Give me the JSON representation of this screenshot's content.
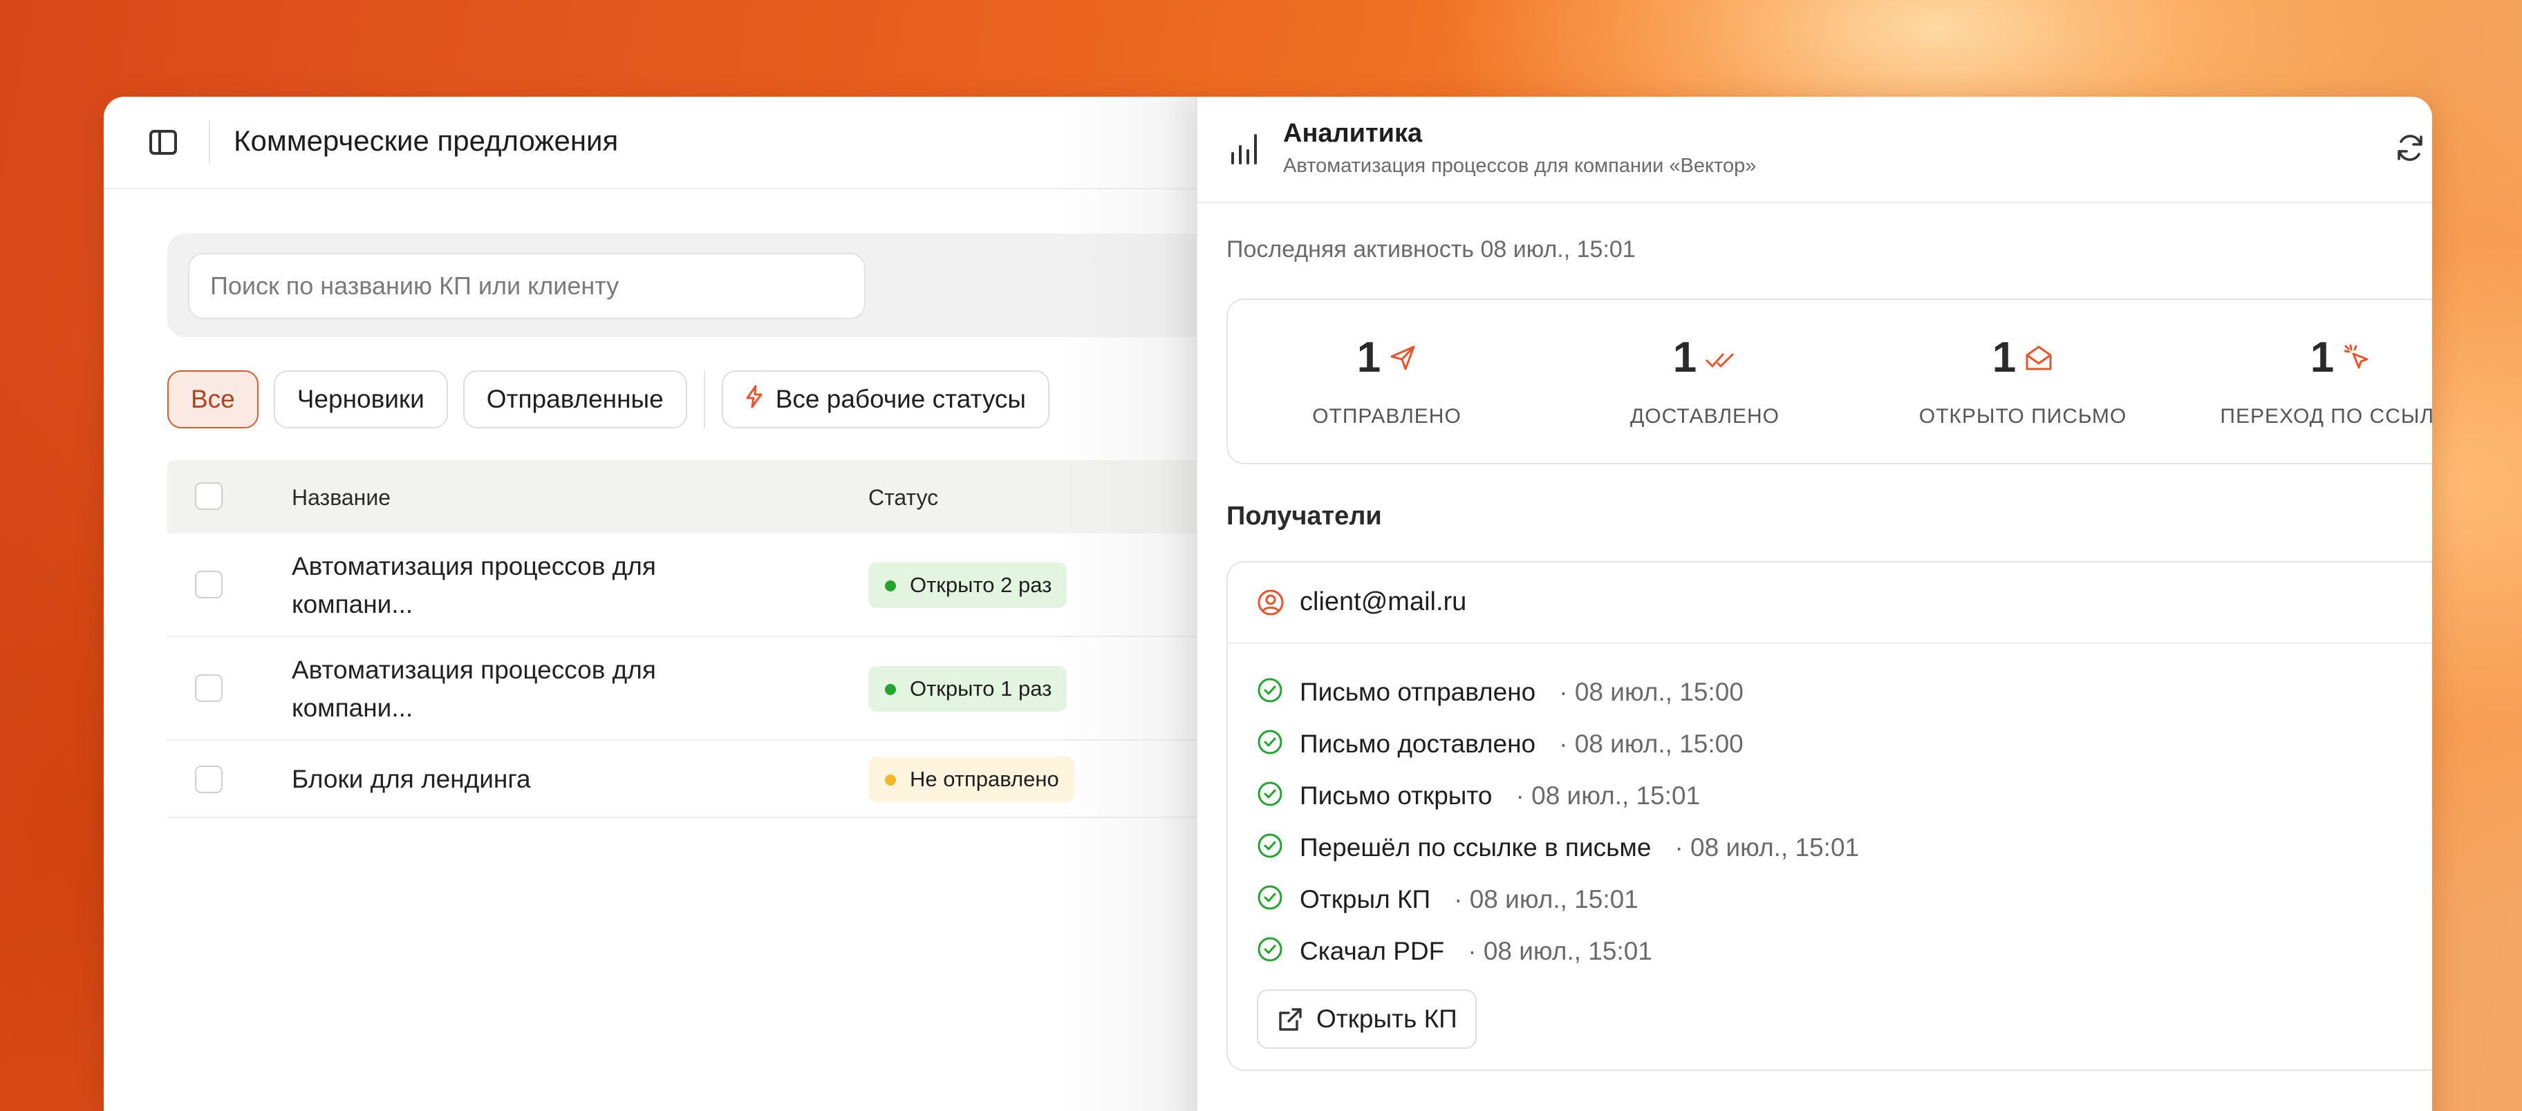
{
  "header": {
    "title": "Коммерческие предложения"
  },
  "search": {
    "placeholder": "Поиск по названию КП или клиенту"
  },
  "filters": [
    {
      "label": "Все",
      "active": true
    },
    {
      "label": "Черновики",
      "active": false
    },
    {
      "label": "Отправленные",
      "active": false
    },
    {
      "label": "Все рабочие статусы",
      "active": false
    }
  ],
  "table": {
    "columns": [
      "Название",
      "Статус"
    ],
    "rows": [
      {
        "name": "Автоматизация процессов для компани...",
        "status": "Открыто 2 раз",
        "status_color": "#22a52e"
      },
      {
        "name": "Автоматизация процессов для компани...",
        "status": "Открыто 1 раз",
        "status_color": "#22a52e"
      },
      {
        "name": "Блоки для лендинга",
        "status": "Не отправлено",
        "status_color": "#f0b824"
      }
    ]
  },
  "panel": {
    "title": "Аналитика",
    "subtitle": "Автоматизация процессов для компании «Вектор»",
    "last_activity": "Последняя активность 08 июл., 15:01",
    "stats": [
      {
        "value": "1",
        "label": "ОТПРАВЛЕНО",
        "icon": "send-icon"
      },
      {
        "value": "1",
        "label": "ДОСТАВЛЕНО",
        "icon": "double-check-icon"
      },
      {
        "value": "1",
        "label": "ОТКРЫТО ПИСЬМО",
        "icon": "mail-open-icon"
      },
      {
        "value": "1",
        "label": "ПЕРЕХОД ПО ССЫЛКЕ",
        "icon": "cursor-click-icon"
      }
    ],
    "recipients_title": "Получатели",
    "recipient": {
      "email": "client@mail.ru",
      "events": [
        {
          "label": "Письмо отправлено",
          "time": "· 08 июл., 15:00"
        },
        {
          "label": "Письмо доставлено",
          "time": "· 08 июл., 15:00"
        },
        {
          "label": "Письмо открыто",
          "time": "· 08 июл., 15:01"
        },
        {
          "label": "Перешёл по ссылке в письме",
          "time": "· 08 июл., 15:01"
        },
        {
          "label": "Открыл КП",
          "time": "· 08 июл., 15:01"
        },
        {
          "label": "Скачал PDF",
          "time": "· 08 июл., 15:01"
        }
      ],
      "open_button": "Открыть КП"
    }
  },
  "colors": {
    "accent": "#e7542a",
    "success": "#22a52e",
    "warning": "#f0b824"
  }
}
